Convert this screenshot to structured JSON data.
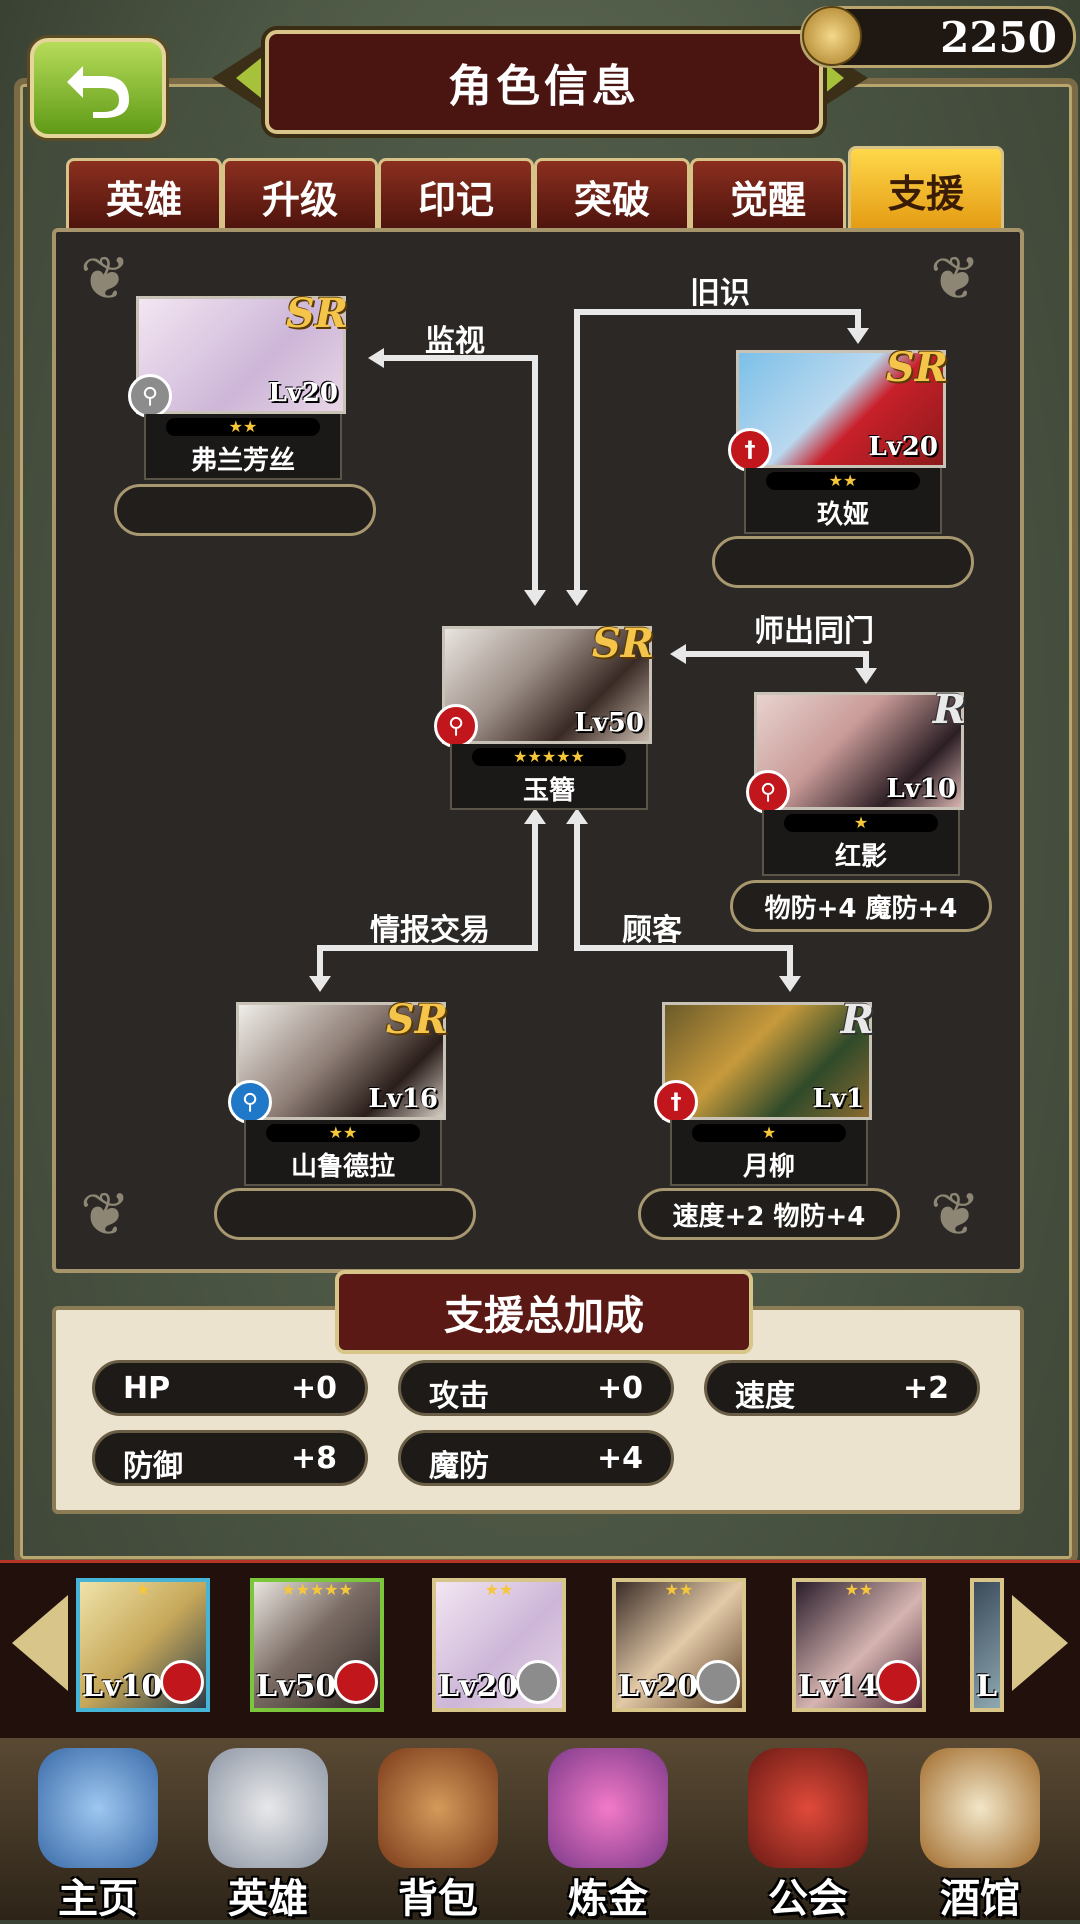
{
  "header": {
    "title": "角色信息",
    "gold": "2250"
  },
  "tabs": [
    {
      "label": "英雄",
      "active": false
    },
    {
      "label": "升级",
      "active": false
    },
    {
      "label": "印记",
      "active": false
    },
    {
      "label": "突破",
      "active": false
    },
    {
      "label": "觉醒",
      "active": false
    },
    {
      "label": "支援",
      "active": true
    }
  ],
  "center": {
    "name": "玉簪",
    "level": "Lv50",
    "rarity": "SR",
    "stars": "★★★★★"
  },
  "supports": [
    {
      "name": "弗兰芳丝",
      "level": "Lv20",
      "rarity": "SR",
      "stars": "★★",
      "relation": "监视",
      "bonus": ""
    },
    {
      "name": "玖娅",
      "level": "Lv20",
      "rarity": "SR",
      "stars": "★★",
      "relation": "旧识",
      "bonus": ""
    },
    {
      "name": "红影",
      "level": "Lv10",
      "rarity": "R",
      "stars": "★",
      "relation": "师出同门",
      "bonus": "物防+4 魔防+4"
    },
    {
      "name": "山鲁德拉",
      "level": "Lv16",
      "rarity": "SR",
      "stars": "★★",
      "relation": "情报交易",
      "bonus": ""
    },
    {
      "name": "月柳",
      "level": "Lv1",
      "rarity": "R",
      "stars": "★",
      "relation": "顾客",
      "bonus": "速度+2 物防+4"
    }
  ],
  "summary": {
    "title": "支援总加成",
    "stats": [
      {
        "label": "HP",
        "value": "+0"
      },
      {
        "label": "攻击",
        "value": "+0"
      },
      {
        "label": "速度",
        "value": "+2"
      },
      {
        "label": "防御",
        "value": "+8"
      },
      {
        "label": "魔防",
        "value": "+4"
      }
    ]
  },
  "roster": [
    {
      "level": "Lv10",
      "stars": "★"
    },
    {
      "level": "Lv50",
      "stars": "★★★★★"
    },
    {
      "level": "Lv20",
      "stars": "★★"
    },
    {
      "level": "Lv20",
      "stars": "★★"
    },
    {
      "level": "Lv14",
      "stars": "★★"
    },
    {
      "level": "L",
      "stars": ""
    }
  ],
  "nav": [
    {
      "label": "主页",
      "icon": "castle-icon"
    },
    {
      "label": "英雄",
      "icon": "helmet-icon"
    },
    {
      "label": "背包",
      "icon": "bag-icon"
    },
    {
      "label": "炼金",
      "icon": "flask-icon"
    },
    {
      "label": "公会",
      "icon": "shield-icon"
    },
    {
      "label": "酒馆",
      "icon": "tavern-icon"
    }
  ],
  "colors": {
    "accent": "#f0b02a",
    "tab_active": "#ffd84a",
    "dark_red": "#5a1914",
    "class_red": "#c0161c",
    "class_blue": "#1f78c8",
    "class_gray": "#8c8c8c"
  }
}
